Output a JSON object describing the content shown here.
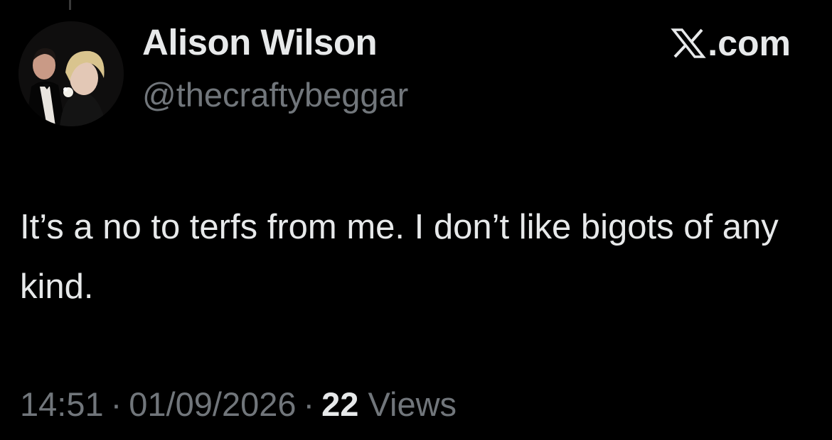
{
  "post": {
    "author": {
      "display_name": "Alison Wilson",
      "handle": "@thecraftybeggar",
      "avatar": "profile-photo"
    },
    "brand": {
      "icon": "x-logo-icon",
      "domain": ".com"
    },
    "text": "It’s a no to terfs from me. I don’t like bigots of any kind.",
    "meta": {
      "time": "14:51",
      "separator": "·",
      "date": "01/09/2026",
      "views_count": "22",
      "views_label": "Views"
    }
  },
  "colors": {
    "background": "#000000",
    "primary_text": "#e7e9ea",
    "secondary_text": "#71767b"
  }
}
